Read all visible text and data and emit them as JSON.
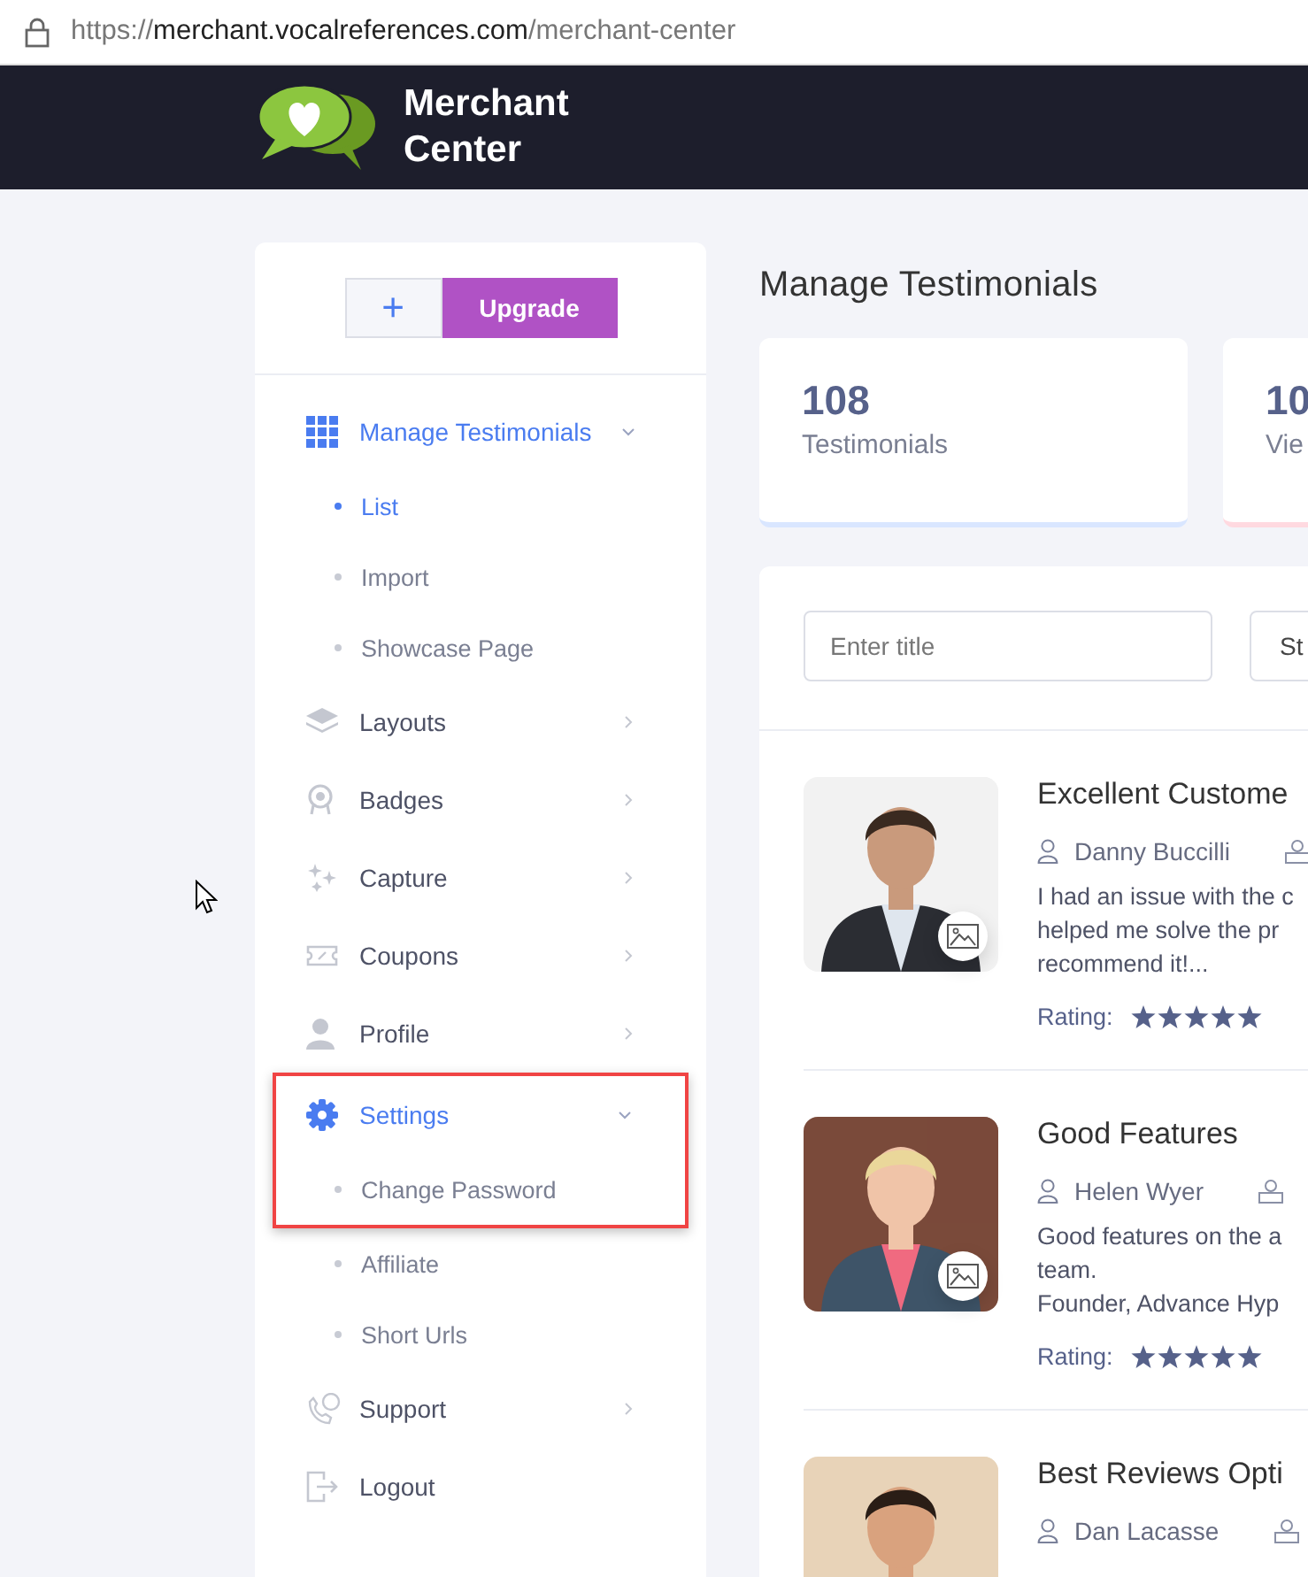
{
  "address_bar": {
    "scheme": "https://",
    "host": "merchant.vocalreferences.com",
    "path": "/merchant-center"
  },
  "brand": "Merchant Center",
  "sidebar": {
    "buttons": [
      {
        "kind": "add",
        "label": "+"
      },
      {
        "kind": "upgrade",
        "label": "Upgrade"
      }
    ],
    "items": [
      {
        "label": "Manage Testimonials",
        "kind": "group",
        "expanded": true,
        "highlighted": false,
        "children": [
          {
            "label": "List",
            "selected": true,
            "highlighted": false
          },
          {
            "label": "Import",
            "selected": false,
            "highlighted": false
          },
          {
            "label": "Showcase Page",
            "selected": false,
            "highlighted": false
          }
        ]
      },
      {
        "label": "Layouts",
        "kind": "group",
        "expanded": false,
        "highlighted": false
      },
      {
        "label": "Badges",
        "kind": "group",
        "expanded": false,
        "highlighted": false
      },
      {
        "label": "Capture",
        "kind": "group",
        "expanded": false,
        "highlighted": false
      },
      {
        "label": "Coupons",
        "kind": "group",
        "expanded": false,
        "highlighted": false
      },
      {
        "label": "Profile",
        "kind": "group",
        "expanded": false,
        "highlighted": false
      },
      {
        "label": "Settings",
        "kind": "group",
        "expanded": true,
        "highlighted": true,
        "children": [
          {
            "label": "Change Password",
            "selected": false,
            "highlighted": true
          },
          {
            "label": "Affiliate",
            "selected": false,
            "highlighted": false
          },
          {
            "label": "Short Urls",
            "selected": false,
            "highlighted": false
          }
        ]
      },
      {
        "label": "Support",
        "kind": "group",
        "expanded": false,
        "highlighted": false
      },
      {
        "label": "Logout",
        "kind": "link",
        "highlighted": false
      }
    ]
  },
  "page_title": "Manage Testimonials",
  "stats": [
    {
      "value": "108",
      "label": "Testimonials",
      "color": "#d9e6ff"
    },
    {
      "value": "10",
      "label": "Vie",
      "color": "#ffd9e0"
    }
  ],
  "filters": {
    "title_field": {
      "placeholder": "Enter title"
    },
    "status_field": {
      "value": "St"
    }
  },
  "testimonials": [
    {
      "title": "Excellent Custome",
      "author": "Danny Buccilli",
      "lines": [
        "I had an issue with the c",
        "helped me solve the pr",
        "recommend it!..."
      ],
      "rating_label": "Rating:",
      "stars": 5
    },
    {
      "title": "Good Features",
      "author": "Helen Wyer",
      "lines": [
        "Good features on the a",
        "team.",
        "Founder, Advance Hyp"
      ],
      "rating_label": "Rating:",
      "stars": 5
    },
    {
      "title": "Best Reviews Opti",
      "author": "Dan Lacasse"
    }
  ]
}
